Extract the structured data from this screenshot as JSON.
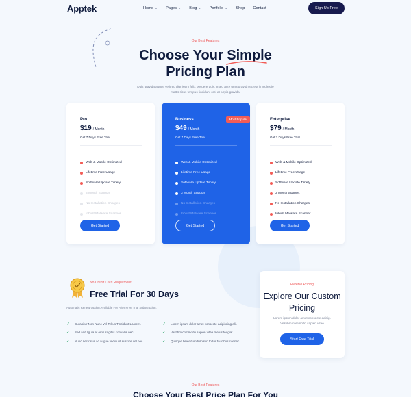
{
  "header": {
    "logo": "Apptek",
    "nav": [
      {
        "label": "Home",
        "has_caret": true
      },
      {
        "label": "Pages",
        "has_caret": true
      },
      {
        "label": "Blog",
        "has_caret": true
      },
      {
        "label": "Portfolio",
        "has_caret": true
      },
      {
        "label": "Shop",
        "has_caret": false
      },
      {
        "label": "Contact",
        "has_caret": false
      }
    ],
    "signup_label": "Sign Up Free"
  },
  "hero": {
    "eyebrow": "Our Best Features",
    "title_line1": "Choose Your Simple",
    "title_line2": "Pricing Plan",
    "description": "Duis gravida augue velit eu dignissim felix posuere quis. Integ ante urna gravid nec est in molestie mattis risus tempus tincidunt orci at turpis gravida."
  },
  "plans": [
    {
      "name": "Pro",
      "price": "$19",
      "per": "/ Month",
      "trial": "Get 7 Days Free Trial",
      "badge": "",
      "features": [
        {
          "label": "Web & Mobile Optimized",
          "enabled": true
        },
        {
          "label": "Lifetime Free Usage",
          "enabled": true
        },
        {
          "label": "Software Update Timely",
          "enabled": true
        },
        {
          "label": "3 Month Support",
          "enabled": false
        },
        {
          "label": "No Installation Charges",
          "enabled": false
        },
        {
          "label": "Inbuilt Malware Scanner",
          "enabled": false
        }
      ],
      "cta": "Get Started"
    },
    {
      "name": "Business",
      "price": "$49",
      "per": "/ Month",
      "trial": "Get 7 Days Free Trial",
      "badge": "Most Popular",
      "features": [
        {
          "label": "Web & Mobile Optimized",
          "enabled": true
        },
        {
          "label": "Lifetime Free Usage",
          "enabled": true
        },
        {
          "label": "Software Update Timely",
          "enabled": true
        },
        {
          "label": "3 Month Support",
          "enabled": true
        },
        {
          "label": "No Installation Charges",
          "enabled": false
        },
        {
          "label": "Inbuilt Malware Scanner",
          "enabled": false
        }
      ],
      "cta": "Get Started"
    },
    {
      "name": "Enterprise",
      "price": "$79",
      "per": "/ Month",
      "trial": "Get 7 Days Free Trial",
      "badge": "",
      "features": [
        {
          "label": "Web & Mobile Optimized",
          "enabled": true
        },
        {
          "label": "Lifetime Free Usage",
          "enabled": true
        },
        {
          "label": "Software Update Timely",
          "enabled": true
        },
        {
          "label": "3 Month Support",
          "enabled": true
        },
        {
          "label": "No Installation Charges",
          "enabled": true
        },
        {
          "label": "Inbuilt Malware Scanner",
          "enabled": true
        }
      ],
      "cta": "Get Started"
    }
  ],
  "free_trial": {
    "eyebrow": "No Credit Card Requirment",
    "title": "Free Trial For 30 Days",
    "description": "Automatic Renew Option Available For After Free Trial Subscription.",
    "left_items": [
      "Curabitur Non Nunc Vel Tellus Tincidunt Laoreet.",
      "Sed sed ligula et eros sagittis convallis nec.",
      "Nunc nec risus ac augue tincidunt suscipit vel nec."
    ],
    "right_items": [
      "Lorem ipsum dolor amet consecte adipiscing elit.",
      "Vestibm commodo sapien vitae metus feugiat.",
      "Quisque bibendum turpis in tortor faucibus connec."
    ]
  },
  "custom": {
    "eyebrow": "Flexible Pricing",
    "title": "Explore Our Custom Pricing",
    "description": "Lorem ipsum dolor amet consecte adisig. Vestibm commodo sapien vitae",
    "cta": "Start Free Trial"
  },
  "bottom": {
    "eyebrow": "Our Best Features",
    "title": "Choose Your Best Price Plan For You"
  },
  "colors": {
    "accent_blue": "#1f63e7",
    "navy": "#171a4e",
    "red_accent": "#f25c56",
    "check_green": "#2ea36a"
  }
}
